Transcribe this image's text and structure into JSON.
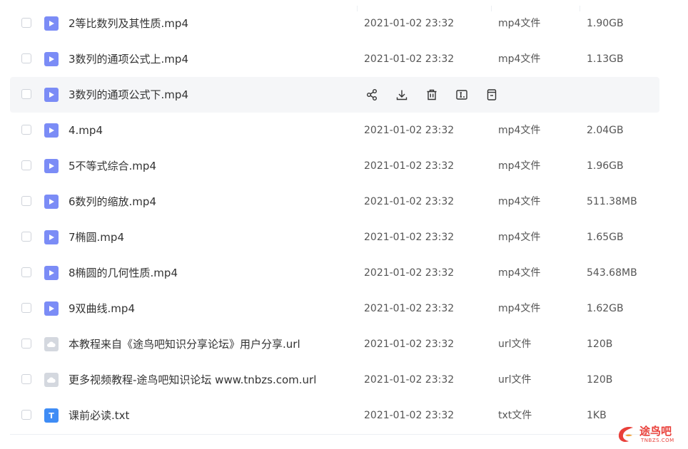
{
  "files": [
    {
      "name": "2等比数列及其性质.mp4",
      "date": "2021-01-02 23:32",
      "type": "mp4文件",
      "size": "1.90GB",
      "icon": "video-file-icon"
    },
    {
      "name": "3数列的通项公式上.mp4",
      "date": "2021-01-02 23:32",
      "type": "mp4文件",
      "size": "1.13GB",
      "icon": "video-file-icon"
    },
    {
      "name": "3数列的通项公式下.mp4",
      "icon": "video-file-icon",
      "hovered": true
    },
    {
      "name": "4.mp4",
      "date": "2021-01-02 23:32",
      "type": "mp4文件",
      "size": "2.04GB",
      "icon": "video-file-icon"
    },
    {
      "name": "5不等式综合.mp4",
      "date": "2021-01-02 23:32",
      "type": "mp4文件",
      "size": "1.96GB",
      "icon": "video-file-icon"
    },
    {
      "name": "6数列的缩放.mp4",
      "date": "2021-01-02 23:32",
      "type": "mp4文件",
      "size": "511.38MB",
      "icon": "video-file-icon"
    },
    {
      "name": "7椭圆.mp4",
      "date": "2021-01-02 23:32",
      "type": "mp4文件",
      "size": "1.65GB",
      "icon": "video-file-icon"
    },
    {
      "name": "8椭圆的几何性质.mp4",
      "date": "2021-01-02 23:32",
      "type": "mp4文件",
      "size": "543.68MB",
      "icon": "video-file-icon"
    },
    {
      "name": "9双曲线.mp4",
      "date": "2021-01-02 23:32",
      "type": "mp4文件",
      "size": "1.62GB",
      "icon": "video-file-icon"
    },
    {
      "name": "本教程来自《途鸟吧知识分享论坛》用户分享.url",
      "date": "2021-01-02 23:32",
      "type": "url文件",
      "size": "120B",
      "icon": "url-file-icon"
    },
    {
      "name": "更多视频教程-途鸟吧知识论坛 www.tnbzs.com.url",
      "date": "2021-01-02 23:32",
      "type": "url文件",
      "size": "120B",
      "icon": "url-file-icon"
    },
    {
      "name": "课前必读.txt",
      "date": "2021-01-02 23:32",
      "type": "txt文件",
      "size": "1KB",
      "icon": "txt-file-icon",
      "glyph": "T"
    }
  ],
  "hover_actions": [
    "share-icon",
    "download-icon",
    "delete-icon",
    "rename-icon",
    "move-icon"
  ],
  "watermark": {
    "name": "途鸟吧",
    "domain": "TNBZS.COM"
  },
  "colors": {
    "video_icon": "#7b8cf6",
    "url_icon": "#d4d8df",
    "txt_icon": "#3f8cf5",
    "hover_row": "#f5f6f8",
    "action_icon": "#333333",
    "watermark": "#e9403a"
  }
}
